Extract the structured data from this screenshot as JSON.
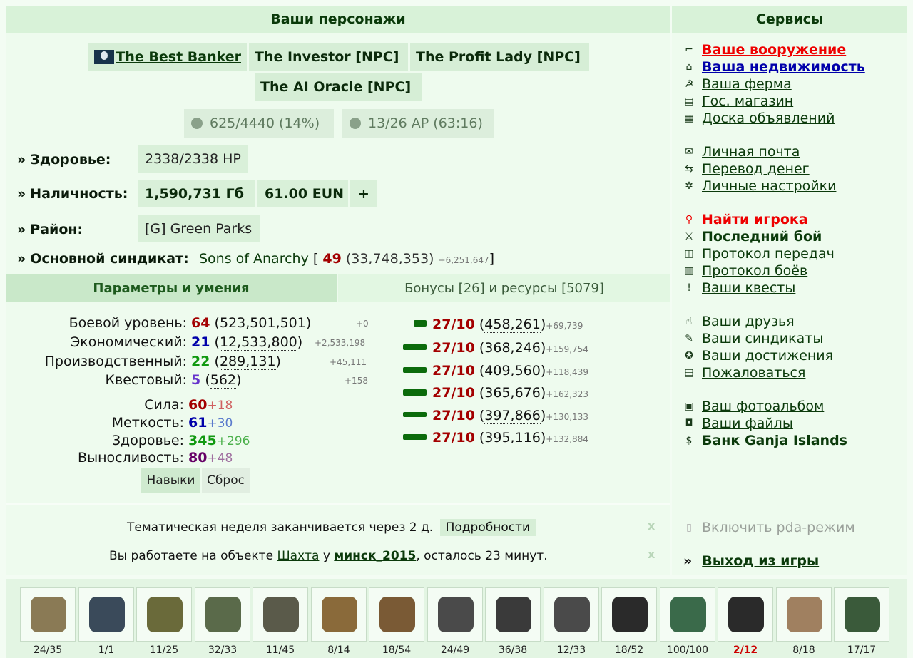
{
  "headers": {
    "characters": "Ваши персонажи",
    "services": "Сервисы"
  },
  "characters": [
    {
      "name": "The Best Banker",
      "active": true
    },
    {
      "name": "The Investor [NPC]"
    },
    {
      "name": "The Profit Lady [NPC]"
    },
    {
      "name": "The AI Oracle [NPC]"
    }
  ],
  "status_pills": {
    "experience": "625/4440 (14%)",
    "ap": "13/26 AP (63:16)"
  },
  "profile": {
    "health_label": "Здоровье:",
    "health_value": "2338/2338 HP",
    "cash_label": "Наличность:",
    "cash_value": "1,590,731 Гб",
    "eun_value": "61.00 EUN",
    "plus": "+",
    "district_label": "Район:",
    "district_value": "[G] Green Parks",
    "syndicate_label": "Основной синдикат:",
    "syndicate_name": "Sons of Anarchy",
    "syndicate_bracket_open": "[",
    "syndicate_rank": "49",
    "syndicate_points": "(33,748,353)",
    "syndicate_delta": "+6,251,647",
    "syndicate_bracket_close": "]"
  },
  "tabs": {
    "params": "Параметры и умения",
    "bonuses": "Бонусы [26] и ресурсы [5079]"
  },
  "levels": [
    {
      "label": "Боевой уровень:",
      "level": "64",
      "exp": "523,501,501",
      "delta": "+0",
      "color": "#a30000"
    },
    {
      "label": "Экономический:",
      "level": "21",
      "exp": "12,533,800",
      "delta": "+2,533,198",
      "color": "#0000aa"
    },
    {
      "label": "Производственный:",
      "level": "22",
      "exp": "289,131",
      "delta": "+45,111",
      "color": "#119911"
    },
    {
      "label": "Квестовый:",
      "level": "5",
      "exp": "562",
      "delta": "+158",
      "color": "#6633cc"
    }
  ],
  "attributes": [
    {
      "label": "Сила:",
      "value": "60",
      "bonus": "+18",
      "color": "#a30000",
      "bcolor": "#d06060"
    },
    {
      "label": "Меткость:",
      "value": "61",
      "bonus": "+30",
      "color": "#0000aa",
      "bcolor": "#5a7acc"
    },
    {
      "label": "Здоровье:",
      "value": "345",
      "bonus": "+296",
      "color": "#119911",
      "bcolor": "#4bb04b"
    },
    {
      "label": "Выносливость:",
      "value": "80",
      "bonus": "+48",
      "color": "#660066",
      "bcolor": "#a070a0"
    }
  ],
  "skill_buttons": {
    "skills": "Навыки",
    "reset": "Сброс"
  },
  "weapon_skills": [
    {
      "icon": "pistol-icon",
      "level": "27/10",
      "exp": "458,261",
      "delta": "+69,739"
    },
    {
      "icon": "grenade-launcher-icon",
      "level": "27/10",
      "exp": "368,246",
      "delta": "+159,754"
    },
    {
      "icon": "assault-rifle-icon",
      "level": "27/10",
      "exp": "409,560",
      "delta": "+118,439"
    },
    {
      "icon": "machine-gun-icon",
      "level": "27/10",
      "exp": "365,676",
      "delta": "+162,323"
    },
    {
      "icon": "shotgun-icon",
      "level": "27/10",
      "exp": "397,866",
      "delta": "+130,133"
    },
    {
      "icon": "sniper-rifle-icon",
      "level": "27/10",
      "exp": "395,116",
      "delta": "+132,884"
    }
  ],
  "notices": {
    "week_text": "Тематическая неделя заканчивается через 2 д.",
    "week_link": "Подробности",
    "work_prefix": "Вы работаете на объекте",
    "work_object": "Шахта",
    "work_mid": "у",
    "work_owner": "минск_2015",
    "work_suffix": ", осталось 23 минут.",
    "close": "x"
  },
  "services": [
    {
      "label": "Ваше вооружение",
      "icon": "pistol-icon",
      "style": "red"
    },
    {
      "label": "Ваша недвижимость",
      "icon": "house-icon",
      "style": "blue"
    },
    {
      "label": "Ваша ферма",
      "icon": "farm-icon",
      "style": ""
    },
    {
      "label": "Гос. магазин",
      "icon": "shop-icon",
      "style": ""
    },
    {
      "label": "Доска объявлений",
      "icon": "board-icon",
      "style": ""
    },
    {
      "label": "Личная почта",
      "icon": "mail-icon",
      "style": ""
    },
    {
      "label": "Перевод денег",
      "icon": "transfer-icon",
      "style": ""
    },
    {
      "label": "Личные настройки",
      "icon": "settings-icon",
      "style": ""
    },
    {
      "label": "Найти игрока",
      "icon": "search-icon",
      "style": "red"
    },
    {
      "label": "Последний бой",
      "icon": "battle-icon",
      "style": "bold"
    },
    {
      "label": "Протокол передач",
      "icon": "transfer-log-icon",
      "style": ""
    },
    {
      "label": "Протокол боёв",
      "icon": "battle-log-icon",
      "style": ""
    },
    {
      "label": "Ваши квесты",
      "icon": "quest-icon",
      "style": ""
    },
    {
      "label": "Ваши друзья",
      "icon": "friends-icon",
      "style": ""
    },
    {
      "label": "Ваши синдикаты",
      "icon": "syndicate-icon",
      "style": ""
    },
    {
      "label": "Ваши достижения",
      "icon": "achievements-icon",
      "style": ""
    },
    {
      "label": "Пожаловаться",
      "icon": "complaint-icon",
      "style": ""
    },
    {
      "label": "Ваш фотоальбом",
      "icon": "photo-icon",
      "style": ""
    },
    {
      "label": "Ваши файлы",
      "icon": "files-icon",
      "style": ""
    },
    {
      "label": "Банк Ganja Islands",
      "icon": "dollar-icon",
      "style": "bold"
    }
  ],
  "pda_mode": "Включить pda-режим",
  "logout": {
    "arrow": "»",
    "label": "Выход из игры"
  },
  "inventory": [
    {
      "item": "sniper-rifle",
      "count": "24/35",
      "color": "#8a7a55"
    },
    {
      "item": "mine",
      "count": "1/1",
      "color": "#3a4a5a"
    },
    {
      "item": "belt",
      "count": "11/25",
      "color": "#6a6a3a"
    },
    {
      "item": "helmet",
      "count": "32/33",
      "color": "#5a6a4a"
    },
    {
      "item": "vest",
      "count": "11/45",
      "color": "#5a5a4a"
    },
    {
      "item": "ghillie-suit",
      "count": "8/14",
      "color": "#8a6a3a"
    },
    {
      "item": "boots",
      "count": "18/54",
      "color": "#7a5a35"
    },
    {
      "item": "vehicle",
      "count": "24/49",
      "color": "#4a4a4a"
    },
    {
      "item": "barbell",
      "count": "36/38",
      "color": "#3a3a3a"
    },
    {
      "item": "wristband",
      "count": "12/33",
      "color": "#4a4a4a"
    },
    {
      "item": "night-vision",
      "count": "18/52",
      "color": "#2a2a2a"
    },
    {
      "item": "device",
      "count": "100/100",
      "color": "#3a6a4a"
    },
    {
      "item": "camera",
      "count": "2/12",
      "color": "#2a2a2a",
      "warn": true
    },
    {
      "item": "beer-mug",
      "count": "8/18",
      "color": "#a08060"
    },
    {
      "item": "gps",
      "count": "17/17",
      "color": "#3a5a3a"
    }
  ]
}
